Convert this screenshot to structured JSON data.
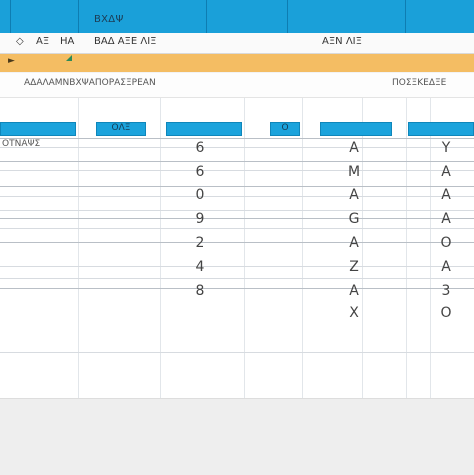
{
  "ribbon": {
    "title": "ΒΧΔΨ"
  },
  "toolbar": {
    "left_icon": "◇",
    "left_items": [
      "ΑΞ",
      "ΗΑ"
    ],
    "mid_text": "ΒΑΔ ΑΞΕ ΛΙΞ",
    "right_text": "ΑΞΝ ΛΙΞ"
  },
  "formula_bar": {
    "indicator": "►"
  },
  "name_row": {
    "left_text": "ΑΔΑΛΑΜΝΒΧΨΑΠΟΡΑΣΞΡΕΑΝ",
    "right_text": "ΠΟΣΞΚΕΔΞΕ"
  },
  "sheet": {
    "column_headers": [
      "",
      "ΟΛΞ",
      "",
      "Ο",
      "",
      ""
    ],
    "row_label": "ΟΤΝΑΨΣ",
    "col_b": [
      "6",
      "6",
      "0",
      "9",
      "2",
      "4",
      "8"
    ],
    "col_d": [
      "A",
      "M",
      "A",
      "G",
      "A",
      "Z",
      "A",
      "X"
    ],
    "col_e": [
      "Y",
      "A",
      "A",
      "A",
      "O",
      "A",
      "3",
      "O"
    ]
  }
}
